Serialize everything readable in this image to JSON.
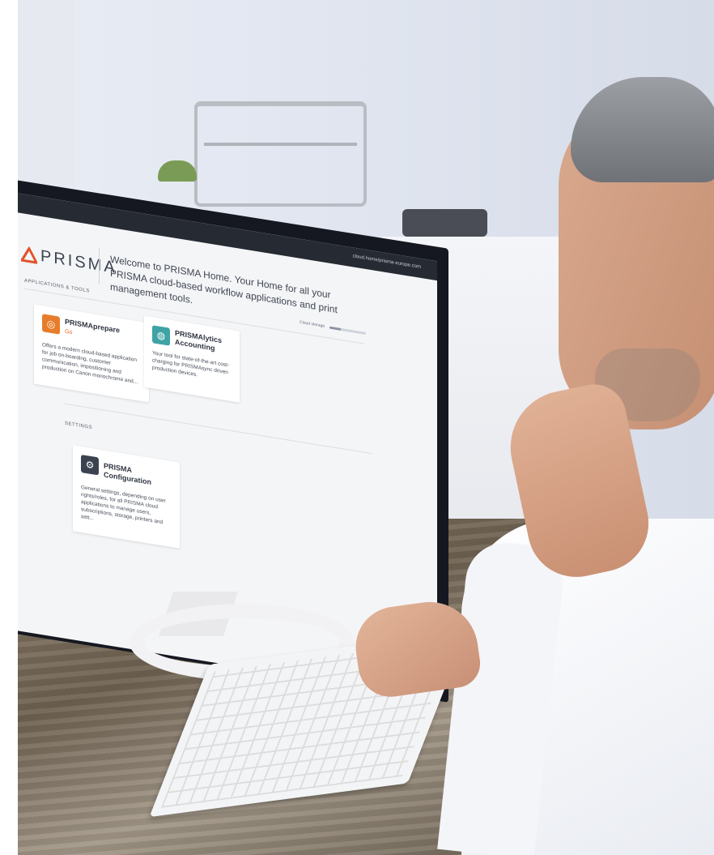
{
  "browser": {
    "url": "cloud.home/prisma-europe.com"
  },
  "brand": {
    "name": "PRISMA",
    "accent": "#e2522a"
  },
  "header": {
    "welcome": "Welcome to PRISMA Home. Your Home for all your PRISMA cloud-based workflow applications and print management tools."
  },
  "storage": {
    "label": "Cloud storage",
    "used_fraction": 0.3
  },
  "apps_section": {
    "label": "APPLICATIONS & TOOLS"
  },
  "apps": [
    {
      "title": "PRISMAprepare",
      "subtitle": "Go",
      "icon": "prepare-icon",
      "color": "#e77d2c",
      "description": "Offers a modern cloud-based application for job on-boarding, customer communication, impositioning and production on Canon monochrome and..."
    },
    {
      "title": "PRISMAlytics Accounting",
      "subtitle": "",
      "icon": "analytics-icon",
      "color": "#3fa3a6",
      "description": "Your tool for state-of-the-art cost-charging for PRISMAsync driven production devices."
    }
  ],
  "settings_section": {
    "label": "SETTINGS"
  },
  "settings": [
    {
      "title": "PRISMA Configuration",
      "icon": "configuration-icon",
      "color": "#3b4250",
      "description": "General settings, depending on user rights/roles, for all PRISMA cloud applications to manage users, subscriptions, storage, printers and sett..."
    }
  ]
}
